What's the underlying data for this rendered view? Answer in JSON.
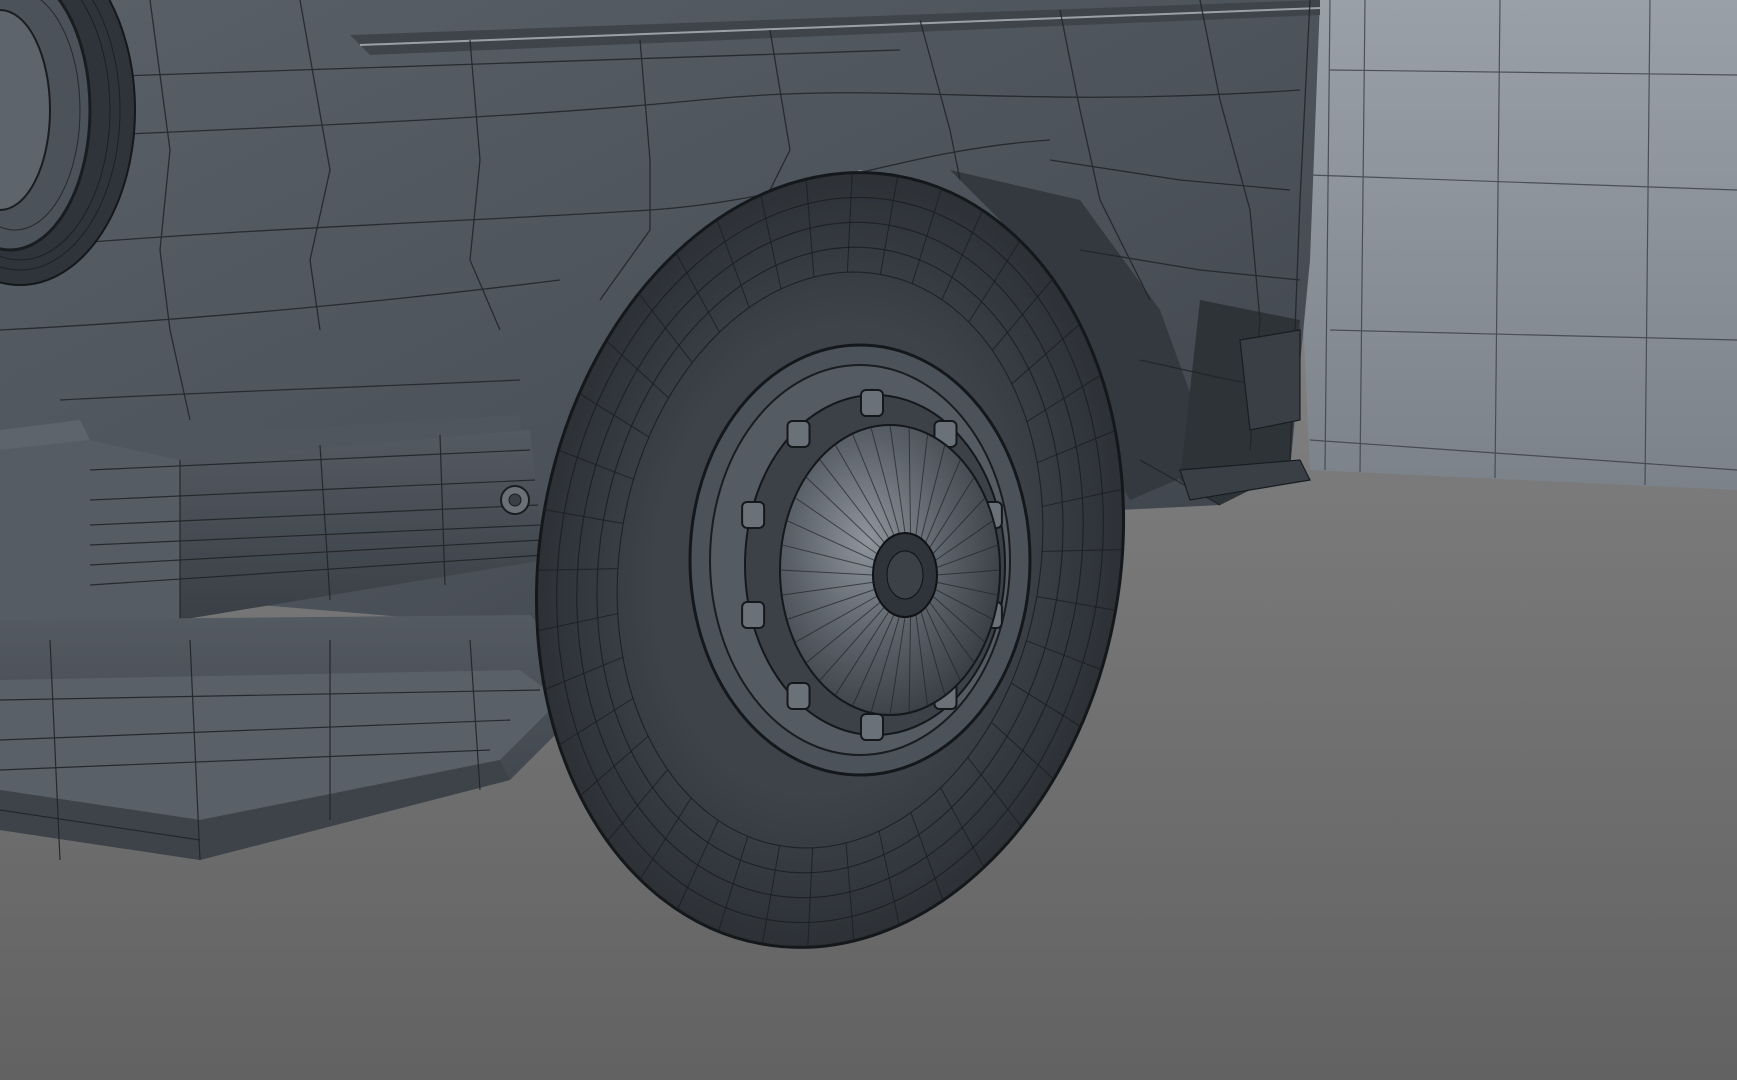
{
  "viewport": {
    "background_floor": "#6a6a6a",
    "background_horizon": "#8d8d8d",
    "body_color": "#4a5058",
    "body_light": "#6c727a",
    "wire_color": "#202428",
    "door_panel_color": "#8a9098"
  },
  "objects": [
    {
      "name": "rear-wheel",
      "kind": "tire-and-rim"
    },
    {
      "name": "spare-tire",
      "kind": "tire"
    },
    {
      "name": "rear-bumper",
      "kind": "bumper"
    },
    {
      "name": "tail-light",
      "kind": "lamp"
    },
    {
      "name": "rear-door",
      "kind": "door-panel"
    }
  ]
}
